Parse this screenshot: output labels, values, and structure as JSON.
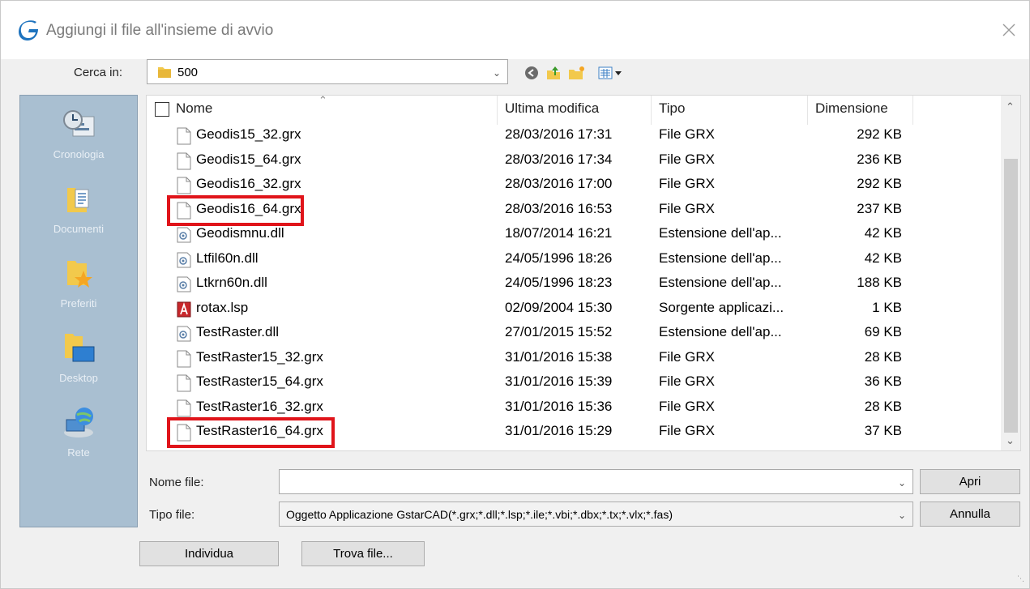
{
  "window": {
    "title": "Aggiungi il file all'insieme di avvio",
    "logo_icon": "gstarcad-logo-icon",
    "accent": "#1e73be"
  },
  "lookin": {
    "label": "Cerca in:",
    "value": "500"
  },
  "toolbar": {
    "icons": [
      "back-icon",
      "up-folder-icon",
      "new-folder-icon",
      "view-menu-icon"
    ]
  },
  "places": [
    {
      "label": "Cronologia",
      "icon": "history-icon"
    },
    {
      "label": "Documenti",
      "icon": "documents-icon"
    },
    {
      "label": "Preferiti",
      "icon": "favorites-icon"
    },
    {
      "label": "Desktop",
      "icon": "desktop-icon"
    },
    {
      "label": "Rete",
      "icon": "network-icon"
    }
  ],
  "columns": {
    "name": "Nome",
    "modified": "Ultima modifica",
    "type": "Tipo",
    "size": "Dimensione"
  },
  "files": [
    {
      "name": "Geodis15_32.grx",
      "modified": "28/03/2016 17:31",
      "type": "File GRX",
      "size": "292 KB",
      "icon": "file-icon",
      "highlighted": false
    },
    {
      "name": "Geodis15_64.grx",
      "modified": "28/03/2016 17:34",
      "type": "File GRX",
      "size": "236 KB",
      "icon": "file-icon",
      "highlighted": false
    },
    {
      "name": "Geodis16_32.grx",
      "modified": "28/03/2016 17:00",
      "type": "File GRX",
      "size": "292 KB",
      "icon": "file-icon",
      "highlighted": false
    },
    {
      "name": "Geodis16_64.grx",
      "modified": "28/03/2016 16:53",
      "type": "File GRX",
      "size": "237 KB",
      "icon": "file-icon",
      "highlighted": true
    },
    {
      "name": "Geodismnu.dll",
      "modified": "18/07/2014 16:21",
      "type": "Estensione dell'ap...",
      "size": "42 KB",
      "icon": "dll-icon",
      "highlighted": false
    },
    {
      "name": "Ltfil60n.dll",
      "modified": "24/05/1996 18:26",
      "type": "Estensione dell'ap...",
      "size": "42 KB",
      "icon": "dll-icon",
      "highlighted": false
    },
    {
      "name": "Ltkrn60n.dll",
      "modified": "24/05/1996 18:23",
      "type": "Estensione dell'ap...",
      "size": "188 KB",
      "icon": "dll-icon",
      "highlighted": false
    },
    {
      "name": "rotax.lsp",
      "modified": "02/09/2004 15:30",
      "type": "Sorgente applicazi...",
      "size": "1 KB",
      "icon": "lisp-icon",
      "highlighted": false
    },
    {
      "name": "TestRaster.dll",
      "modified": "27/01/2015 15:52",
      "type": "Estensione dell'ap...",
      "size": "69 KB",
      "icon": "dll-icon",
      "highlighted": false
    },
    {
      "name": "TestRaster15_32.grx",
      "modified": "31/01/2016 15:38",
      "type": "File GRX",
      "size": "28 KB",
      "icon": "file-icon",
      "highlighted": false
    },
    {
      "name": "TestRaster15_64.grx",
      "modified": "31/01/2016 15:39",
      "type": "File GRX",
      "size": "36 KB",
      "icon": "file-icon",
      "highlighted": false
    },
    {
      "name": "TestRaster16_32.grx",
      "modified": "31/01/2016 15:36",
      "type": "File GRX",
      "size": "28 KB",
      "icon": "file-icon",
      "highlighted": false
    },
    {
      "name": "TestRaster16_64.grx",
      "modified": "31/01/2016 15:29",
      "type": "File GRX",
      "size": "37 KB",
      "icon": "file-icon",
      "highlighted": true
    }
  ],
  "filename": {
    "label": "Nome file:",
    "value": ""
  },
  "filetype": {
    "label": "Tipo file:",
    "value": "Oggetto Applicazione GstarCAD(*.grx;*.dll;*.lsp;*.ile;*.vbi;*.dbx;*.tx;*.vlx;*.fas)"
  },
  "buttons": {
    "open": "Apri",
    "cancel": "Annulla",
    "locate": "Individua",
    "find": "Trova file..."
  },
  "highlight_color": "#e0141a"
}
